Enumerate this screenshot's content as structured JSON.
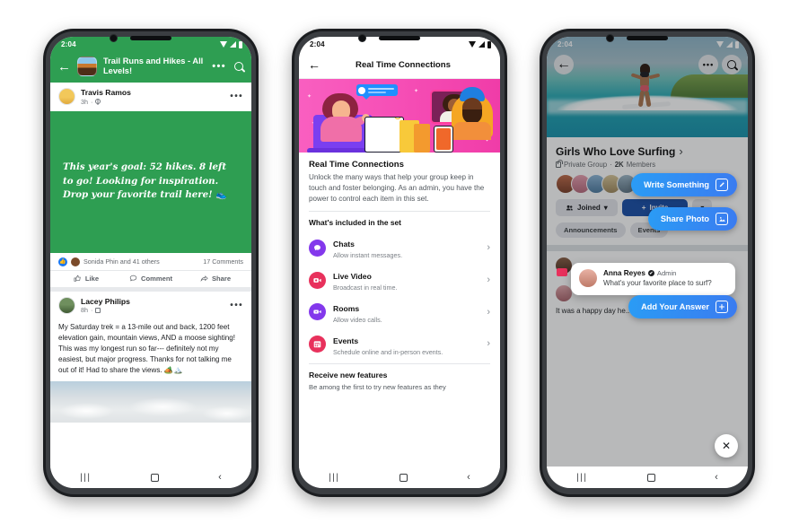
{
  "meta": {
    "accent_blue": "#1877f2",
    "fb_green": "#2e9e52",
    "pink": "#f64fb6",
    "cta_gradient_from": "#2a9cf5",
    "cta_gradient_to": "#3b7bf0"
  },
  "status_bar": {
    "time": "2:04",
    "wifi_icon": "wifi-icon",
    "signal_icon": "signal-icon",
    "battery_icon": "battery-icon"
  },
  "nav_bar": {
    "recents_icon": "recents-icon",
    "recents_glyph": "|||",
    "home_icon": "home-icon",
    "back_icon": "back-icon",
    "back_glyph": "‹"
  },
  "phone1": {
    "header": {
      "back_icon": "back-arrow-icon",
      "back_glyph": "←",
      "group_avatar": "group-cover-thumbnail",
      "group_name": "Trail Runs and Hikes - All Levels!",
      "menu_icon": "overflow-menu-icon",
      "menu_glyph": "•••",
      "search_icon": "search-icon"
    },
    "post1": {
      "author": "Travis Ramos",
      "time": "3h",
      "privacy_icon": "globe-icon",
      "menu_glyph": "•••",
      "body": "This year's goal: 52 hikes. 8 left to go! Looking for inspiration. Drop your favorite trail here! 👟",
      "reactions_text": "Sonida Phin and 41 others",
      "comments_text": "17 Comments",
      "like_label": "Like",
      "comment_label": "Comment",
      "share_label": "Share"
    },
    "post2": {
      "author": "Lacey Philips",
      "time": "8h",
      "privacy_icon": "group-icon",
      "menu_glyph": "•••",
      "body": "My Saturday trek = a 13-mile out and back, 1200 feet elevation gain, mountain views, AND a moose sighting! This was my longest run so far--- definitely not my easiest, but major progress. Thanks for not talking me out of it! Had to share the views. 🏕️🏔️",
      "photo_alt": "mountain-sky-photo"
    }
  },
  "phone2": {
    "header": {
      "back_icon": "back-arrow-icon",
      "back_glyph": "←",
      "title": "Real Time Connections"
    },
    "hero_alt": "real-time-connections-illustration",
    "section": {
      "title": "Real Time Connections",
      "description": "Unlock the many ways that help your group keep in touch and foster belonging. As an admin, you have the power to control each item in this set."
    },
    "included_header": "What's included in the set",
    "items": [
      {
        "title": "Chats",
        "subtitle": "Allow instant messages.",
        "icon": "chat-bubble-icon",
        "color": "#8338ec",
        "chevron": "›"
      },
      {
        "title": "Live Video",
        "subtitle": "Broadcast in real time.",
        "icon": "live-video-icon",
        "color": "#e8315c",
        "chevron": "›"
      },
      {
        "title": "Rooms",
        "subtitle": "Allow video calls.",
        "icon": "video-room-icon",
        "color": "#8338ec",
        "chevron": "›"
      },
      {
        "title": "Events",
        "subtitle": "Schedule online and in-person events.",
        "icon": "calendar-icon",
        "color": "#e8315c",
        "chevron": "›"
      }
    ],
    "footer": {
      "title": "Receive new features",
      "subtitle": "Be among the first to try new features as they"
    }
  },
  "phone3": {
    "cover_alt": "surfer-riding-wave-cover-photo",
    "cover_back_icon": "back-arrow-icon",
    "cover_back_glyph": "←",
    "cover_menu_icon": "overflow-menu-icon",
    "cover_menu_glyph": "•••",
    "cover_search_icon": "search-icon",
    "group": {
      "name": "Girls Who Love Surfing",
      "name_chevron": "›",
      "privacy_icon": "lock-icon",
      "privacy": "Private Group",
      "separator": "·",
      "members_count": "2K",
      "members_label": "Members",
      "members_more_glyph": "•••"
    },
    "buttons": {
      "joined_label": "Joined",
      "joined_icon": "members-icon",
      "joined_caret": "▾",
      "invite_label": "Invite",
      "invite_icon": "plus-icon",
      "invite_plus": "+",
      "more_caret": "▾"
    },
    "tabs": [
      {
        "label": "Announcements"
      },
      {
        "label": "Events"
      }
    ],
    "composer_placeholder": "Write something...",
    "feed_post_text": "It was a happy day he...",
    "question_card": {
      "author": "Anna Reyes",
      "verified_icon": "admin-badge-icon",
      "verified_glyph": "✔",
      "role": "Admin",
      "question": "What's your favorite place to surf?"
    },
    "ctas": [
      {
        "label": "Write Something",
        "icon": "compose-icon",
        "glyph": "✎"
      },
      {
        "label": "Share Photo",
        "icon": "photo-icon",
        "glyph": "⛰"
      },
      {
        "label": "Add Your Answer",
        "icon": "add-answer-icon",
        "glyph": "+"
      }
    ],
    "close_icon": "close-icon",
    "close_glyph": "✕"
  }
}
